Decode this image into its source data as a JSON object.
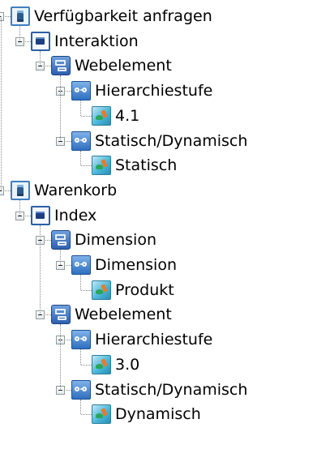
{
  "tree": [
    {
      "label": "Verfügbarkeit anfragen",
      "icon": "database-icon",
      "children": [
        {
          "label": "Interaktion",
          "icon": "table-icon",
          "children": [
            {
              "label": "Webelement",
              "icon": "folder-icon",
              "children": [
                {
                  "label": "Hierarchiestufe",
                  "icon": "attribute-icon",
                  "children": [
                    {
                      "label": "4.1",
                      "icon": "value-icon"
                    }
                  ]
                },
                {
                  "label": "Statisch/Dynamisch",
                  "icon": "attribute-icon",
                  "children": [
                    {
                      "label": "Statisch",
                      "icon": "value-icon"
                    }
                  ]
                }
              ]
            }
          ]
        }
      ]
    },
    {
      "label": "Warenkorb",
      "icon": "database-icon",
      "children": [
        {
          "label": "Index",
          "icon": "table-icon",
          "children": [
            {
              "label": "Dimension",
              "icon": "folder-icon",
              "children": [
                {
                  "label": "Dimension",
                  "icon": "attribute-icon",
                  "children": [
                    {
                      "label": "Produkt",
                      "icon": "value-icon"
                    }
                  ]
                }
              ]
            },
            {
              "label": "Webelement",
              "icon": "folder-icon",
              "children": [
                {
                  "label": "Hierarchiestufe",
                  "icon": "attribute-icon",
                  "children": [
                    {
                      "label": "3.0",
                      "icon": "value-icon"
                    }
                  ]
                },
                {
                  "label": "Statisch/Dynamisch",
                  "icon": "attribute-icon",
                  "children": [
                    {
                      "label": "Dynamisch",
                      "icon": "value-icon"
                    }
                  ]
                }
              ]
            }
          ]
        }
      ]
    }
  ]
}
